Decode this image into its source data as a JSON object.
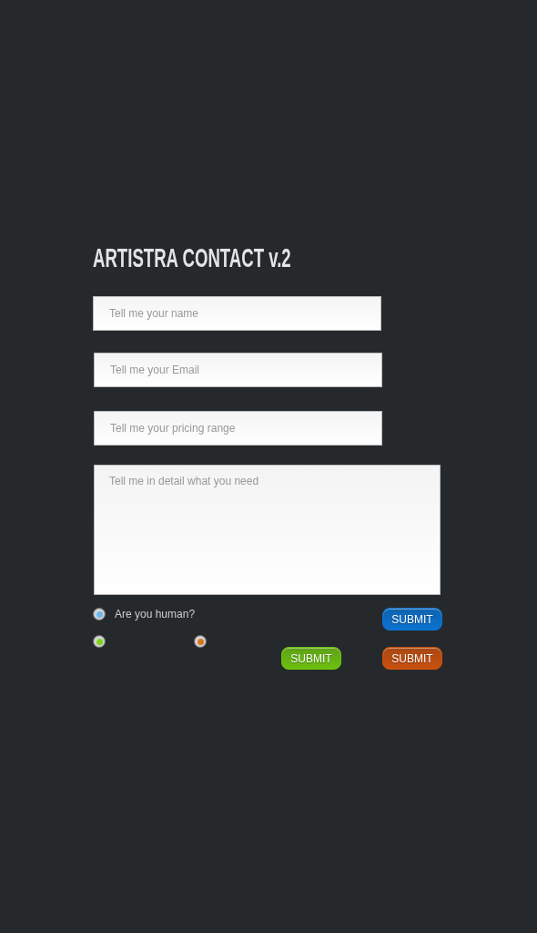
{
  "title": "ARTISTRA CONTACT v.2",
  "fields": [
    {
      "kind": "input",
      "placeholder": "Tell me your name"
    },
    {
      "kind": "input",
      "placeholder": "Tell me your Email"
    },
    {
      "kind": "input",
      "placeholder": "Tell me your pricing range"
    },
    {
      "kind": "textarea",
      "placeholder": "Tell me in detail what you need"
    }
  ],
  "rows": [
    {
      "radios": [
        {
          "label": "Are you human?",
          "selected": true,
          "color": "#6ab8ef"
        }
      ],
      "buttons": [
        {
          "label": "SUBMIT",
          "color": "#0a72d0"
        }
      ]
    },
    {
      "radios": [
        {
          "selected": true,
          "color": "#7fd21e"
        },
        {
          "selected": true,
          "color": "#d8761f"
        }
      ],
      "buttons": [
        {
          "label": "SUBMIT",
          "color": "#6cc010"
        },
        {
          "label": "SUBMIT",
          "color": "#c9500e"
        }
      ]
    }
  ]
}
